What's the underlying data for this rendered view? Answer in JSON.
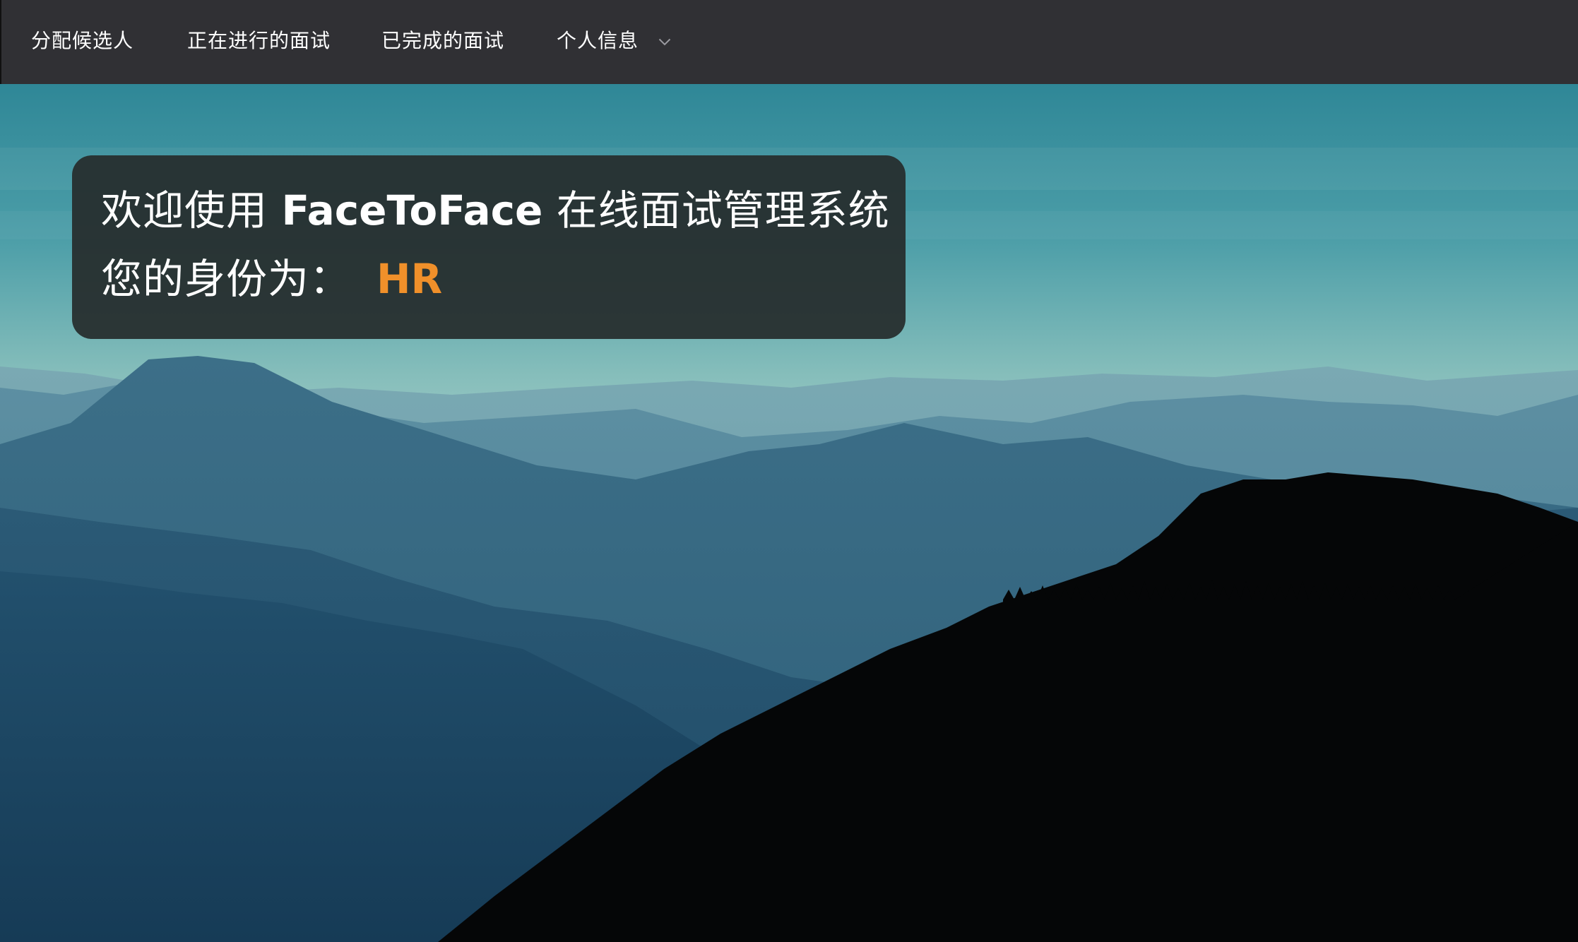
{
  "nav": {
    "items": [
      {
        "label": "分配候选人"
      },
      {
        "label": "正在进行的面试"
      },
      {
        "label": "已完成的面试"
      },
      {
        "label": "个人信息",
        "icon": "chevron-down-icon"
      }
    ]
  },
  "welcome": {
    "prefix": "欢迎使用 ",
    "brand": "FaceToFace",
    "suffix": " 在线面试管理系统",
    "role_prefix": "您的身份为：",
    "role": "HR"
  },
  "colors": {
    "navbar": "#303034",
    "card": "#262c2c",
    "role_accent": "#f0902a",
    "sky_top": "#2f8797",
    "sky_bottom": "#a9cfca"
  }
}
